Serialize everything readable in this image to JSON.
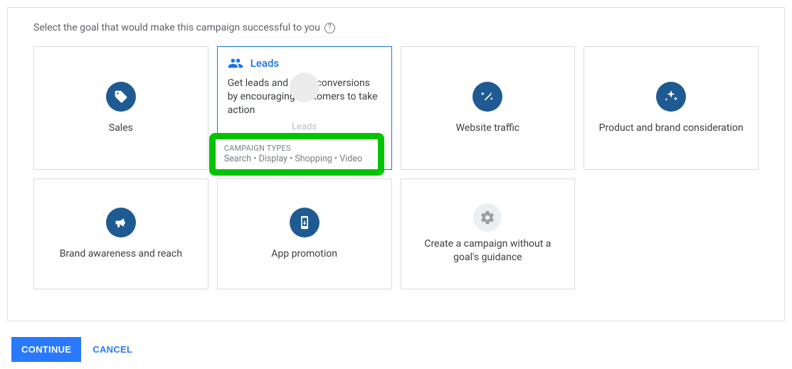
{
  "heading": "Select the goal that would make this campaign successful to you",
  "cards": {
    "sales": {
      "label": "Sales"
    },
    "leads": {
      "label": "Leads",
      "description": "Get leads and other conversions by encouraging customers to take action",
      "ghost_label": "Leads",
      "campaign_types_heading": "CAMPAIGN TYPES",
      "campaign_types": "Search • Display • Shopping • Video"
    },
    "website_traffic": {
      "label": "Website traffic"
    },
    "product_brand": {
      "label": "Product and brand consideration"
    },
    "brand_awareness": {
      "label": "Brand awareness and reach"
    },
    "app_promotion": {
      "label": "App promotion"
    },
    "no_goal": {
      "label": "Create a campaign without a goal's guidance"
    }
  },
  "actions": {
    "continue": "CONTINUE",
    "cancel": "CANCEL"
  }
}
